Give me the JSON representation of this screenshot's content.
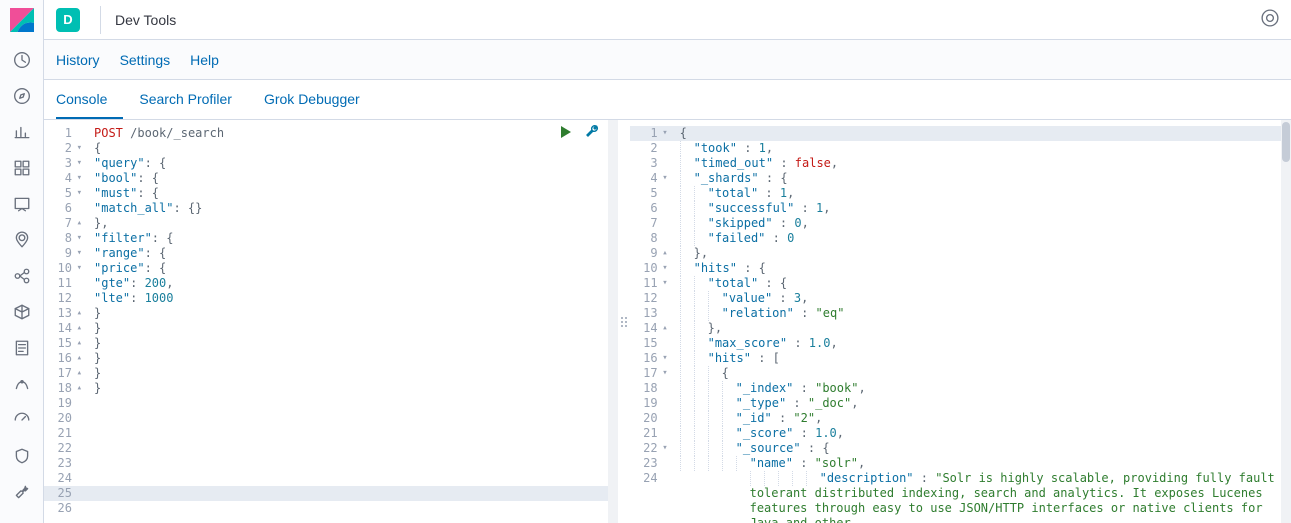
{
  "app": {
    "badge": "D",
    "title": "Dev Tools"
  },
  "menu": {
    "history": "History",
    "settings": "Settings",
    "help": "Help"
  },
  "tabs": {
    "console": "Console",
    "profiler": "Search Profiler",
    "grok": "Grok Debugger"
  },
  "request": {
    "method": "POST",
    "path": "/book/_search",
    "body": {
      "query": {
        "bool": {
          "must": {
            "match_all": {}
          },
          "filter": {
            "range": {
              "price": {
                "gte": 200,
                "lte": 1000
              }
            }
          }
        }
      }
    },
    "lines": [
      {
        "n": 1,
        "fold": "",
        "tokens": [
          [
            "method",
            "POST"
          ],
          [
            "space",
            " "
          ],
          [
            "path",
            "/book/_search"
          ]
        ]
      },
      {
        "n": 2,
        "fold": "open",
        "tokens": [
          [
            "punc",
            "{"
          ]
        ]
      },
      {
        "n": 3,
        "fold": "open",
        "tokens": [
          [
            "key",
            "\"query\""
          ],
          [
            "punc",
            ": {"
          ]
        ]
      },
      {
        "n": 4,
        "fold": "open",
        "tokens": [
          [
            "key",
            "\"bool\""
          ],
          [
            "punc",
            ": {"
          ]
        ]
      },
      {
        "n": 5,
        "fold": "open",
        "tokens": [
          [
            "key",
            "\"must\""
          ],
          [
            "punc",
            ": {"
          ]
        ]
      },
      {
        "n": 6,
        "fold": "",
        "tokens": [
          [
            "key",
            "\"match_all\""
          ],
          [
            "punc",
            ": {}"
          ]
        ]
      },
      {
        "n": 7,
        "fold": "close",
        "tokens": [
          [
            "punc",
            "},"
          ]
        ]
      },
      {
        "n": 8,
        "fold": "open",
        "tokens": [
          [
            "key",
            "\"filter\""
          ],
          [
            "punc",
            ": {"
          ]
        ]
      },
      {
        "n": 9,
        "fold": "open",
        "tokens": [
          [
            "key",
            "\"range\""
          ],
          [
            "punc",
            ": {"
          ]
        ]
      },
      {
        "n": 10,
        "fold": "open",
        "tokens": [
          [
            "key",
            "\"price\""
          ],
          [
            "punc",
            ": {"
          ]
        ]
      },
      {
        "n": 11,
        "fold": "",
        "tokens": [
          [
            "key",
            "\"gte\""
          ],
          [
            "punc",
            ": "
          ],
          [
            "num",
            "200"
          ],
          [
            "punc",
            ","
          ]
        ]
      },
      {
        "n": 12,
        "fold": "",
        "tokens": [
          [
            "key",
            "\"lte\""
          ],
          [
            "punc",
            ": "
          ],
          [
            "num",
            "1000"
          ]
        ]
      },
      {
        "n": 13,
        "fold": "close",
        "tokens": [
          [
            "punc",
            "}"
          ]
        ]
      },
      {
        "n": 14,
        "fold": "close",
        "tokens": [
          [
            "punc",
            "}"
          ]
        ]
      },
      {
        "n": 15,
        "fold": "close",
        "tokens": [
          [
            "punc",
            "}"
          ]
        ]
      },
      {
        "n": 16,
        "fold": "close",
        "tokens": [
          [
            "punc",
            "}"
          ]
        ]
      },
      {
        "n": 17,
        "fold": "close",
        "tokens": [
          [
            "punc",
            "}"
          ]
        ]
      },
      {
        "n": 18,
        "fold": "close",
        "tokens": [
          [
            "punc",
            "}"
          ]
        ]
      },
      {
        "n": 19,
        "fold": "",
        "tokens": []
      },
      {
        "n": 20,
        "fold": "",
        "tokens": []
      },
      {
        "n": 21,
        "fold": "",
        "tokens": []
      },
      {
        "n": 22,
        "fold": "",
        "tokens": []
      },
      {
        "n": 23,
        "fold": "",
        "tokens": []
      },
      {
        "n": 24,
        "fold": "",
        "tokens": []
      },
      {
        "n": 25,
        "fold": "",
        "tokens": [],
        "hl": true
      },
      {
        "n": 26,
        "fold": "",
        "tokens": []
      }
    ]
  },
  "response": {
    "lines": [
      {
        "n": 1,
        "fold": "open",
        "indent": 0,
        "tokens": [
          [
            "punc",
            "{"
          ]
        ],
        "hl": true
      },
      {
        "n": 2,
        "fold": "",
        "indent": 1,
        "tokens": [
          [
            "key",
            "\"took\""
          ],
          [
            "punc",
            " : "
          ],
          [
            "num",
            "1"
          ],
          [
            "punc",
            ","
          ]
        ]
      },
      {
        "n": 3,
        "fold": "",
        "indent": 1,
        "tokens": [
          [
            "key",
            "\"timed_out\""
          ],
          [
            "punc",
            " : "
          ],
          [
            "bool",
            "false"
          ],
          [
            "punc",
            ","
          ]
        ]
      },
      {
        "n": 4,
        "fold": "open",
        "indent": 1,
        "tokens": [
          [
            "key",
            "\"_shards\""
          ],
          [
            "punc",
            " : {"
          ]
        ]
      },
      {
        "n": 5,
        "fold": "",
        "indent": 2,
        "tokens": [
          [
            "key",
            "\"total\""
          ],
          [
            "punc",
            " : "
          ],
          [
            "num",
            "1"
          ],
          [
            "punc",
            ","
          ]
        ]
      },
      {
        "n": 6,
        "fold": "",
        "indent": 2,
        "tokens": [
          [
            "key",
            "\"successful\""
          ],
          [
            "punc",
            " : "
          ],
          [
            "num",
            "1"
          ],
          [
            "punc",
            ","
          ]
        ]
      },
      {
        "n": 7,
        "fold": "",
        "indent": 2,
        "tokens": [
          [
            "key",
            "\"skipped\""
          ],
          [
            "punc",
            " : "
          ],
          [
            "num",
            "0"
          ],
          [
            "punc",
            ","
          ]
        ]
      },
      {
        "n": 8,
        "fold": "",
        "indent": 2,
        "tokens": [
          [
            "key",
            "\"failed\""
          ],
          [
            "punc",
            " : "
          ],
          [
            "num",
            "0"
          ]
        ]
      },
      {
        "n": 9,
        "fold": "close",
        "indent": 1,
        "tokens": [
          [
            "punc",
            "},"
          ]
        ]
      },
      {
        "n": 10,
        "fold": "open",
        "indent": 1,
        "tokens": [
          [
            "key",
            "\"hits\""
          ],
          [
            "punc",
            " : {"
          ]
        ]
      },
      {
        "n": 11,
        "fold": "open",
        "indent": 2,
        "tokens": [
          [
            "key",
            "\"total\""
          ],
          [
            "punc",
            " : {"
          ]
        ]
      },
      {
        "n": 12,
        "fold": "",
        "indent": 3,
        "tokens": [
          [
            "key",
            "\"value\""
          ],
          [
            "punc",
            " : "
          ],
          [
            "num",
            "3"
          ],
          [
            "punc",
            ","
          ]
        ]
      },
      {
        "n": 13,
        "fold": "",
        "indent": 3,
        "tokens": [
          [
            "key",
            "\"relation\""
          ],
          [
            "punc",
            " : "
          ],
          [
            "str",
            "\"eq\""
          ]
        ]
      },
      {
        "n": 14,
        "fold": "close",
        "indent": 2,
        "tokens": [
          [
            "punc",
            "},"
          ]
        ]
      },
      {
        "n": 15,
        "fold": "",
        "indent": 2,
        "tokens": [
          [
            "key",
            "\"max_score\""
          ],
          [
            "punc",
            " : "
          ],
          [
            "num",
            "1.0"
          ],
          [
            "punc",
            ","
          ]
        ]
      },
      {
        "n": 16,
        "fold": "open",
        "indent": 2,
        "tokens": [
          [
            "key",
            "\"hits\""
          ],
          [
            "punc",
            " : ["
          ]
        ]
      },
      {
        "n": 17,
        "fold": "open",
        "indent": 3,
        "tokens": [
          [
            "punc",
            "{"
          ]
        ]
      },
      {
        "n": 18,
        "fold": "",
        "indent": 4,
        "tokens": [
          [
            "key",
            "\"_index\""
          ],
          [
            "punc",
            " : "
          ],
          [
            "str",
            "\"book\""
          ],
          [
            "punc",
            ","
          ]
        ]
      },
      {
        "n": 19,
        "fold": "",
        "indent": 4,
        "tokens": [
          [
            "key",
            "\"_type\""
          ],
          [
            "punc",
            " : "
          ],
          [
            "str",
            "\"_doc\""
          ],
          [
            "punc",
            ","
          ]
        ]
      },
      {
        "n": 20,
        "fold": "",
        "indent": 4,
        "tokens": [
          [
            "key",
            "\"_id\""
          ],
          [
            "punc",
            " : "
          ],
          [
            "str",
            "\"2\""
          ],
          [
            "punc",
            ","
          ]
        ]
      },
      {
        "n": 21,
        "fold": "",
        "indent": 4,
        "tokens": [
          [
            "key",
            "\"_score\""
          ],
          [
            "punc",
            " : "
          ],
          [
            "num",
            "1.0"
          ],
          [
            "punc",
            ","
          ]
        ]
      },
      {
        "n": 22,
        "fold": "open",
        "indent": 4,
        "tokens": [
          [
            "key",
            "\"_source\""
          ],
          [
            "punc",
            " : {"
          ]
        ]
      },
      {
        "n": 23,
        "fold": "",
        "indent": 5,
        "tokens": [
          [
            "key",
            "\"name\""
          ],
          [
            "punc",
            " : "
          ],
          [
            "str",
            "\"solr\""
          ],
          [
            "punc",
            ","
          ]
        ]
      },
      {
        "n": 24,
        "fold": "",
        "indent": 5,
        "tokens": [
          [
            "key",
            "\"description\""
          ],
          [
            "punc",
            " : "
          ],
          [
            "str",
            "\"Solr is highly scalable, providing fully fault tolerant distributed indexing, search and analytics. It exposes Lucenes features through easy to use JSON/HTTP interfaces or native clients for Java and other"
          ]
        ]
      }
    ]
  },
  "sidebar_icons": [
    "recent",
    "discover",
    "visualize",
    "dashboard",
    "canvas",
    "maps",
    "ml",
    "infrastructure",
    "logs",
    "apm",
    "uptime",
    "siem",
    "dev-tools"
  ]
}
